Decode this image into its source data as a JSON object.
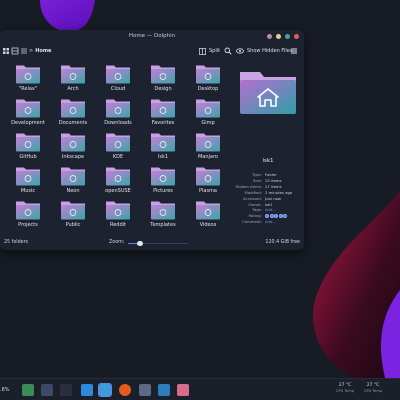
{
  "window": {
    "title": "Home — Dolphin",
    "buttons": {
      "minimize_color": "#b48ead",
      "maximize_color": "#ebcb8b",
      "restore_color": "#4fa095",
      "close_color": "#e15a6a"
    }
  },
  "toolbar": {
    "breadcrumb_separator": ">",
    "location": "Home",
    "split_label": "Split",
    "show_hidden_label": "Show Hidden Files"
  },
  "files": [
    {
      "name": "\"Relax\"",
      "emblem": "share-icon"
    },
    {
      "name": "Arch",
      "emblem": "arch-icon"
    },
    {
      "name": "Cloud",
      "emblem": "cloud-icon"
    },
    {
      "name": "Design",
      "emblem": "design-icon"
    },
    {
      "name": "Desktop",
      "emblem": "desktop-icon"
    },
    {
      "name": "Development",
      "emblem": "code-icon"
    },
    {
      "name": "Documents",
      "emblem": "document-icon"
    },
    {
      "name": "Downloads",
      "emblem": "download-icon"
    },
    {
      "name": "Favorites",
      "emblem": "star-icon"
    },
    {
      "name": "Gimp",
      "emblem": "gimp-icon"
    },
    {
      "name": "GitHub",
      "emblem": "github-icon"
    },
    {
      "name": "Inkscape",
      "emblem": "inkscape-icon"
    },
    {
      "name": "KDE",
      "emblem": "kde-icon"
    },
    {
      "name": "lsk1",
      "emblem": "leaf-icon"
    },
    {
      "name": "Manjaro",
      "emblem": "manjaro-icon"
    },
    {
      "name": "Music",
      "emblem": "music-icon"
    },
    {
      "name": "Neon",
      "emblem": "neon-icon"
    },
    {
      "name": "openSUSE",
      "emblem": "opensuse-icon"
    },
    {
      "name": "Pictures",
      "emblem": "picture-icon"
    },
    {
      "name": "Plasma",
      "emblem": "plasma-icon"
    },
    {
      "name": "Projects",
      "emblem": "project-icon"
    },
    {
      "name": "Public",
      "emblem": "public-icon"
    },
    {
      "name": "Reddit",
      "emblem": "reddit-icon"
    },
    {
      "name": "Templates",
      "emblem": "template-icon"
    },
    {
      "name": "Videos",
      "emblem": "video-icon"
    }
  ],
  "info": {
    "name": "lsk1",
    "fields": [
      {
        "key": "Type:",
        "value": "Folder"
      },
      {
        "key": "Size:",
        "value": "25 items"
      },
      {
        "key": "Hidden items:",
        "value": "27 items"
      },
      {
        "key": "Modified:",
        "value": "2 minutes ago"
      },
      {
        "key": "Accessed:",
        "value": "Just now"
      },
      {
        "key": "Owner:",
        "value": "lsk1"
      },
      {
        "key": "Tags:",
        "value": "Add..."
      },
      {
        "key": "Rating:",
        "value": ""
      },
      {
        "key": "Comment:",
        "value": "Add..."
      }
    ],
    "rating_stars": 5
  },
  "status": {
    "count": "25 folders",
    "zoom_label": "Zoom:",
    "zoom_level": 0.2,
    "free_space": "120.4 GiB free"
  },
  "taskbar": {
    "left_text": ".8%",
    "apps": [
      "mountains-icon",
      "cpu-icon",
      "pen-icon",
      "store-icon",
      "dolphin-icon",
      "firefox-icon",
      "settings-icon",
      "kmail-icon",
      "picture-viewer-icon"
    ],
    "cpu_temp": "27 °C",
    "cpu_label": "CPU Temp",
    "gpu_temp": "27 °C",
    "gpu_label": "GPU Temp"
  },
  "colors": {
    "accent": "#5f86e4",
    "folder_top": "#c27fd6",
    "folder_bottom": "#3aa5a8",
    "window_bg": "#1d2230"
  }
}
